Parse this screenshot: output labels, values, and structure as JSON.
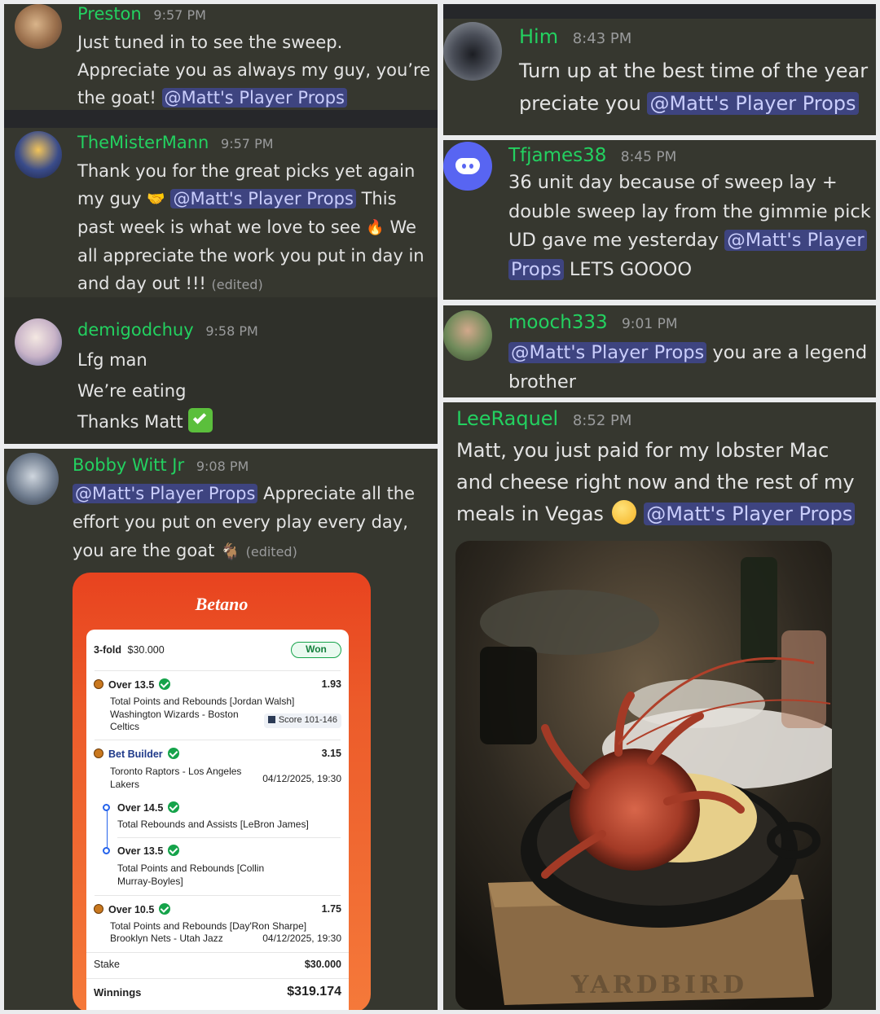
{
  "messages": {
    "preston": {
      "username": "Preston",
      "time": "9:57 PM",
      "line1": "Just tuned in to see the sweep.",
      "line2": "Appreciate you as always my guy, you’re",
      "line3": "the goat!",
      "mention": "@Matt's Player Props"
    },
    "mistermann": {
      "username": "TheMisterMann",
      "time": "9:57 PM",
      "line1": "Thank you for the great picks yet again",
      "line2a": "my guy",
      "mention": "@Matt's Player Props",
      "line2b": "This",
      "line3a": "past week is what we love to see",
      "line3b": "We",
      "line4": "all appreciate the work you put in day in",
      "line5": "and day out !!!",
      "edited": "(edited)"
    },
    "demigod": {
      "username": "demigodchuy",
      "time": "9:58 PM",
      "line1": "Lfg man",
      "line2": "We’re eating",
      "line3": "Thanks Matt"
    },
    "bobby": {
      "username": "Bobby Witt Jr",
      "time": "9:08 PM",
      "mention": "@Matt's Player Props",
      "line1b": "Appreciate all the",
      "line2": "effort you put on every play every day,",
      "line3": "you are the goat",
      "edited": "(edited)"
    },
    "him": {
      "username": "Him",
      "time": "8:43 PM",
      "line1": "Turn up at the best time of the year",
      "line2a": "preciate you",
      "mention": "@Matt's Player Props"
    },
    "tfjames": {
      "username": "Tfjames38",
      "time": "8:45 PM",
      "line1": "36 unit day because of sweep lay +",
      "line2": "double sweep lay from the gimmie pick",
      "line3a": "UD gave me yesterday",
      "mention_a": "@Matt's Player",
      "mention_b": "Props",
      "line4b": "LETS GOOOO"
    },
    "mooch": {
      "username": "mooch333",
      "time": "9:01 PM",
      "mention": "@Matt's Player Props",
      "line1b": "you are a legend",
      "line2": "brother"
    },
    "lee": {
      "username": "LeeRaquel",
      "time": "8:52 PM",
      "line1": "Matt, you just paid for my lobster Mac",
      "line2": "and cheese right now and the rest of my",
      "line3": "meals in Vegas",
      "mention": "@Matt's Player Props",
      "photo_sign": "YARDBIRD"
    }
  },
  "betslip": {
    "brand": "Betano",
    "type": "3-fold",
    "amount": "$30.000",
    "status": "Won",
    "legs": [
      {
        "title": "Over 13.5",
        "odds": "1.93",
        "market": "Total Points and Rebounds [Jordan Walsh]",
        "match_a": "Washington Wizards - Boston",
        "match_b": "Celtics",
        "score": "Score 101-146"
      },
      {
        "title": "Bet Builder",
        "odds": "3.15",
        "match_a": "Toronto Raptors - Los Angeles",
        "match_b": "Lakers",
        "datetime": "04/12/2025, 19:30",
        "sub": [
          {
            "title": "Over 14.5",
            "market": "Total Rebounds and Assists [LeBron James]"
          },
          {
            "title": "Over 13.5",
            "market_a": "Total Points and Rebounds [Collin",
            "market_b": "Murray-Boyles]"
          }
        ]
      },
      {
        "title": "Over 10.5",
        "odds": "1.75",
        "market": "Total Points and Rebounds [Day'Ron Sharpe]",
        "match": "Brooklyn Nets - Utah Jazz",
        "datetime": "04/12/2025, 19:30"
      }
    ],
    "stake_label": "Stake",
    "stake": "$30.000",
    "winnings_label": "Winnings",
    "winnings": "$319.174"
  },
  "colors": {
    "username": "#23d160",
    "mention_bg": "#3e4480",
    "panel": "#36372f",
    "betano": "#e8431f"
  }
}
